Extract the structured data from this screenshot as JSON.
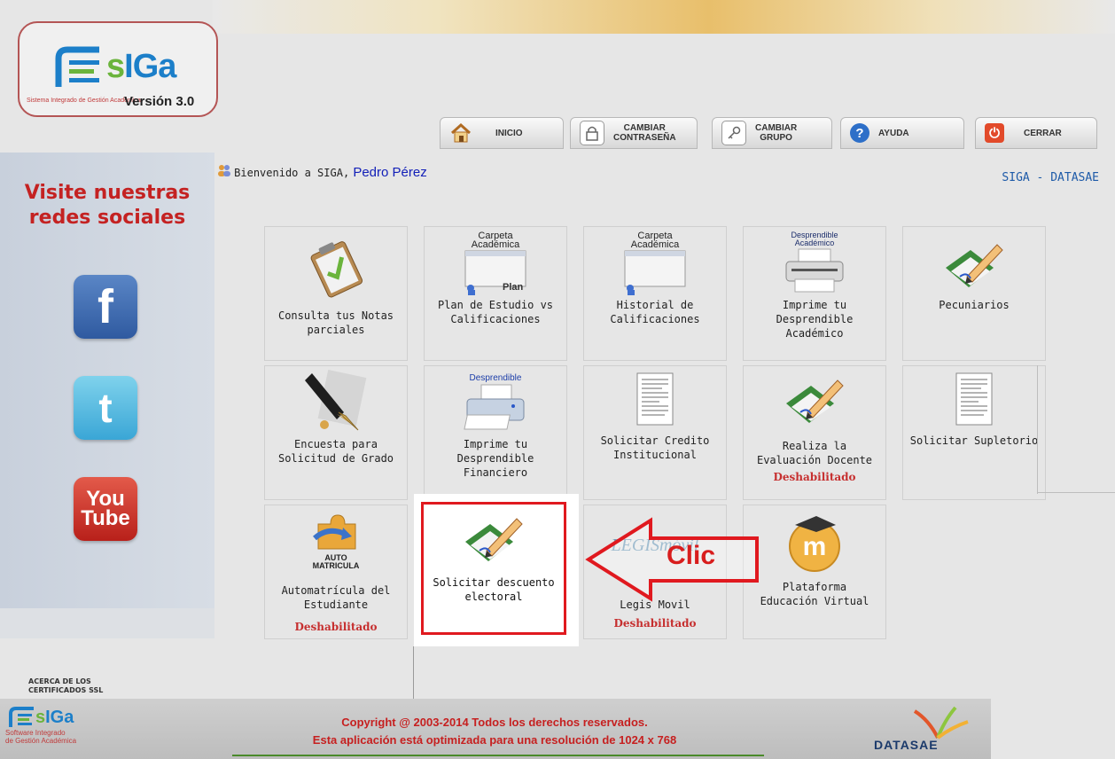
{
  "header": {
    "logo_name": "SIGA",
    "logo_subtitle": "Sistema Integrado de Gestión Académica",
    "version": "Versión 3.0"
  },
  "nav": {
    "inicio": "INICIO",
    "cambiar_contrasena_1": "CAMBIAR",
    "cambiar_contrasena_2": "CONTRASEÑA",
    "cambiar_grupo_1": "CAMBIAR",
    "cambiar_grupo_2": "GRUPO",
    "ayuda": "AYUDA",
    "cerrar": "CERRAR"
  },
  "welcome": {
    "text": "Bienvenido a SIGA,",
    "user": "Pedro Pérez",
    "brand": "SIGA - DATASAE"
  },
  "sidebar": {
    "title_1": "Visite nuestras",
    "title_2": "redes sociales",
    "social": [
      "facebook",
      "twitter",
      "youtube"
    ],
    "youtube_1": "You",
    "youtube_2": "Tube"
  },
  "tiles": {
    "notas_1": "Consulta tus Notas",
    "notas_2": "parciales",
    "plan_caption_1": "Carpeta",
    "plan_caption_2": "Académica",
    "plan_tag": "Plan",
    "plan_1": "Plan de Estudio vs",
    "plan_2": "Calificaciones",
    "historial_caption_1": "Carpeta",
    "historial_caption_2": "Académica",
    "historial_1": "Historial de",
    "historial_2": "Calificaciones",
    "academico_caption_1": "Desprendible",
    "academico_caption_2": "Académico",
    "academico_1": "Imprime tu",
    "academico_2": "Desprendible",
    "academico_3": "Académico",
    "pecuniarios": "Pecuniarios",
    "encuesta_1": "Encuesta para",
    "encuesta_2": "Solicitud de Grado",
    "financiero_caption": "Desprendible",
    "financiero_1": "Imprime tu",
    "financiero_2": "Desprendible",
    "financiero_3": "Financiero",
    "credito_1": "Solicitar Credito",
    "credito_2": "Institucional",
    "evaluacion_1": "Realiza la",
    "evaluacion_2": "Evaluación Docente",
    "evaluacion_status": "Deshabilitado",
    "supletorio": "Solicitar Supletorio",
    "auto_caption_1": "AUTO",
    "auto_caption_2": "MATRICULA",
    "auto_1": "Automatrícula del",
    "auto_2": "Estudiante",
    "auto_status": "Deshabilitado",
    "descuento_1": "Solicitar descuento",
    "descuento_2": "electoral",
    "legis_logo": "LEGISmóvil",
    "legis": "Legis Movil",
    "legis_status": "Deshabilitado",
    "virtual_1": "Plataforma",
    "virtual_2": "Educación Virtual"
  },
  "annotation": {
    "label": "Clic",
    "color": "#e0191f"
  },
  "footer": {
    "ssl_1": "ACERCA DE LOS",
    "ssl_2": "CERTIFICADOS SSL",
    "logo_name": "SIGA",
    "logo_sub_1": "Software Integrado",
    "logo_sub_2": "de Gestión Académica",
    "copyright": "Copyright @ 2003-2014 Todos los derechos reservados.",
    "resolution": "Esta aplicación está optimizada para una resolución de 1024 x 768",
    "company": "DATASAE"
  }
}
